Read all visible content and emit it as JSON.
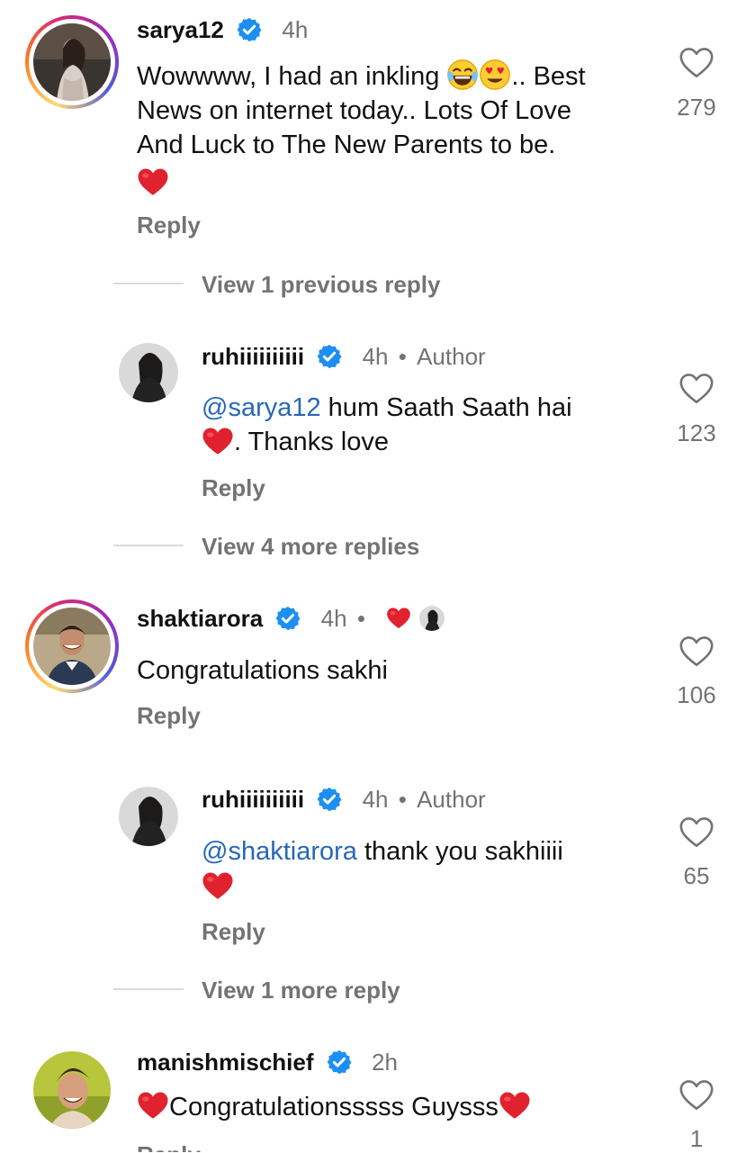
{
  "colors": {
    "accent": "#2767b8",
    "verified": "#1d8ff2",
    "muted": "#737373",
    "heart": "#e0222e"
  },
  "comments": [
    {
      "username": "sarya12",
      "time": "4h",
      "text_line1_a": "Wowwww, I had an inkling ",
      "text_line1_b": ".. Best",
      "text_line2": "News on internet today.. Lots Of Love",
      "text_line3": "And Luck to The New Parents to be.",
      "likes": "279",
      "reply_label": "Reply",
      "view_replies": "View 1 previous reply"
    },
    {
      "username": "ruhiiiiiiiiii",
      "time": "4h",
      "author_label": "Author",
      "mention": "@sarya12",
      "text_line1": " hum Saath Saath hai",
      "text_line2": ". Thanks love",
      "likes": "123",
      "reply_label": "Reply",
      "view_replies": "View 4 more replies"
    },
    {
      "username": "shaktiarora",
      "time": "4h",
      "text_line1": "Congratulations sakhi",
      "likes": "106",
      "reply_label": "Reply"
    },
    {
      "username": "ruhiiiiiiiiii",
      "time": "4h",
      "author_label": "Author",
      "mention": "@shaktiarora",
      "text_line1": " thank you sakhiiii",
      "likes": "65",
      "reply_label": "Reply",
      "view_replies": "View 1 more reply"
    },
    {
      "username": "manishmischief",
      "time": "2h",
      "text_line1": "Congratulationsssss Guysss",
      "likes": "1",
      "reply_label": "Reply"
    }
  ]
}
